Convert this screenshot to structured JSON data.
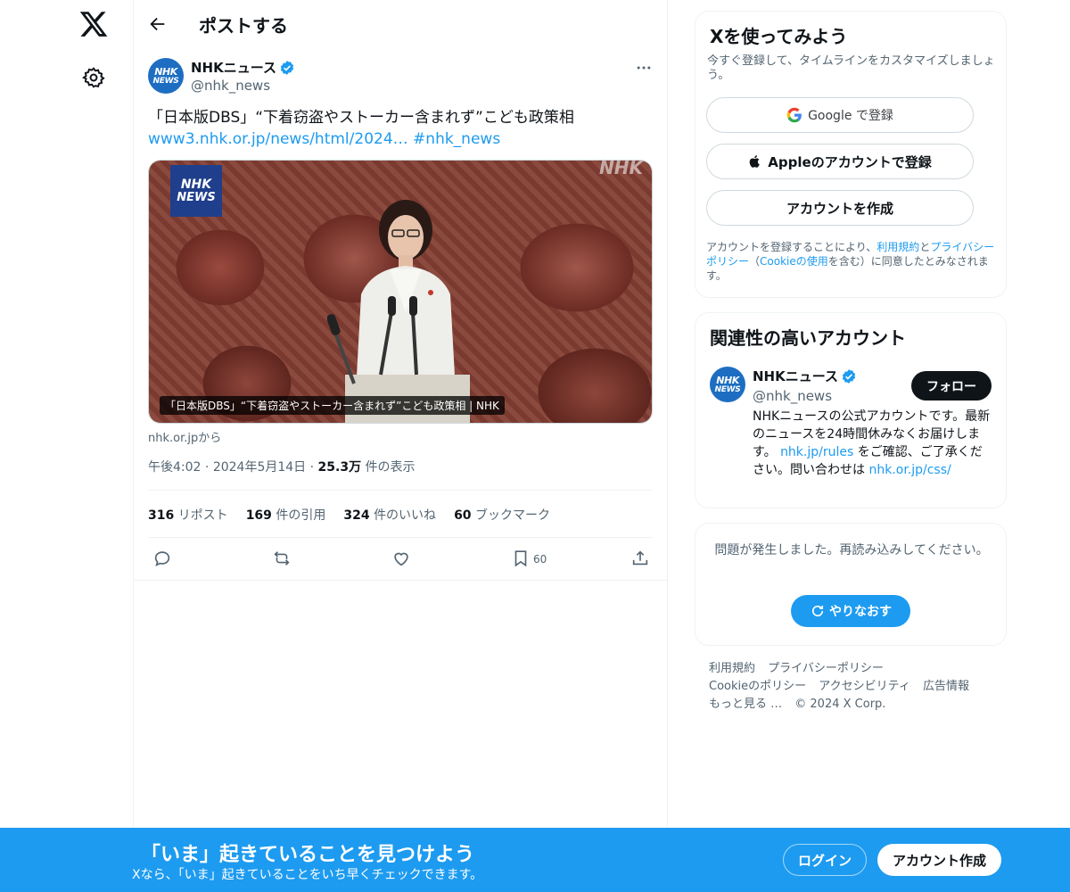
{
  "page": {
    "title": "ポストする"
  },
  "post": {
    "author_name": "NHKニュース",
    "author_handle": "@nhk_news",
    "avatar_text_1": "NHK",
    "avatar_text_2": "NEWS",
    "text_line1": "「日本版DBS」“下着窃盗やストーカー含まれず”こども政策相",
    "link": "www3.nhk.or.jp/news/html/2024…",
    "hashtag": "#nhk_news",
    "media_badge_1": "NHK",
    "media_badge_2": "NEWS",
    "media_watermark": "NHK",
    "media_caption": "「日本版DBS」“下着窃盗やストーカー含まれず”こども政策相 | NHK",
    "source": "nhk.or.jpから",
    "time": "午後4:02",
    "date": "2024年5月14日",
    "views": "25.3万",
    "views_label": "件の表示",
    "sep": "·",
    "stats": {
      "reposts": "316",
      "reposts_label": "リポスト",
      "quotes": "169",
      "quotes_label": "件の引用",
      "likes": "324",
      "likes_label": "件のいいね",
      "bookmarks": "60",
      "bookmarks_label": "ブックマーク"
    },
    "bookmark_count": "60"
  },
  "signup_card": {
    "title": "Xを使ってみよう",
    "subtitle": "今すぐ登録して、タイムラインをカスタマイズしましょう。",
    "google_label": "Google で登録",
    "apple_label": "Appleのアカウントで登録",
    "create_label": "アカウントを作成",
    "legal_1": "アカウントを登録することにより、",
    "legal_terms": "利用規約",
    "legal_2": "と",
    "legal_privacy": "プライバシーポリシー",
    "legal_3": "（",
    "legal_cookie": "Cookieの使用",
    "legal_4": "を含む）に同意したとみなされます。"
  },
  "related": {
    "title": "関連性の高いアカウント",
    "name": "NHKニュース",
    "handle": "@nhk_news",
    "follow_label": "フォロー",
    "bio_1": "NHKニュースの公式アカウントです。最新のニュースを24時間休みなくお届けします。 ",
    "bio_link1": "nhk.jp/rules",
    "bio_2": " をご確認、ご了承ください。問い合わせは ",
    "bio_link2": "nhk.or.jp/css/"
  },
  "error_card": {
    "message": "問題が発生しました。再読み込みしてください。",
    "retry_label": "やりなおす"
  },
  "footer": {
    "links": [
      "利用規約",
      "プライバシーポリシー",
      "Cookieのポリシー",
      "アクセシビリティ",
      "広告情報",
      "もっと見る …"
    ],
    "copyright": "© 2024 X Corp."
  },
  "bottom_bar": {
    "title": "「いま」起きていることを見つけよう",
    "subtitle": "Xなら、「いま」起きていることをいち早くチェックできます。",
    "login_label": "ログイン",
    "signup_label": "アカウント作成"
  },
  "colors": {
    "accent": "#1d9bf0",
    "text": "#0f1419",
    "muted": "#536471"
  }
}
